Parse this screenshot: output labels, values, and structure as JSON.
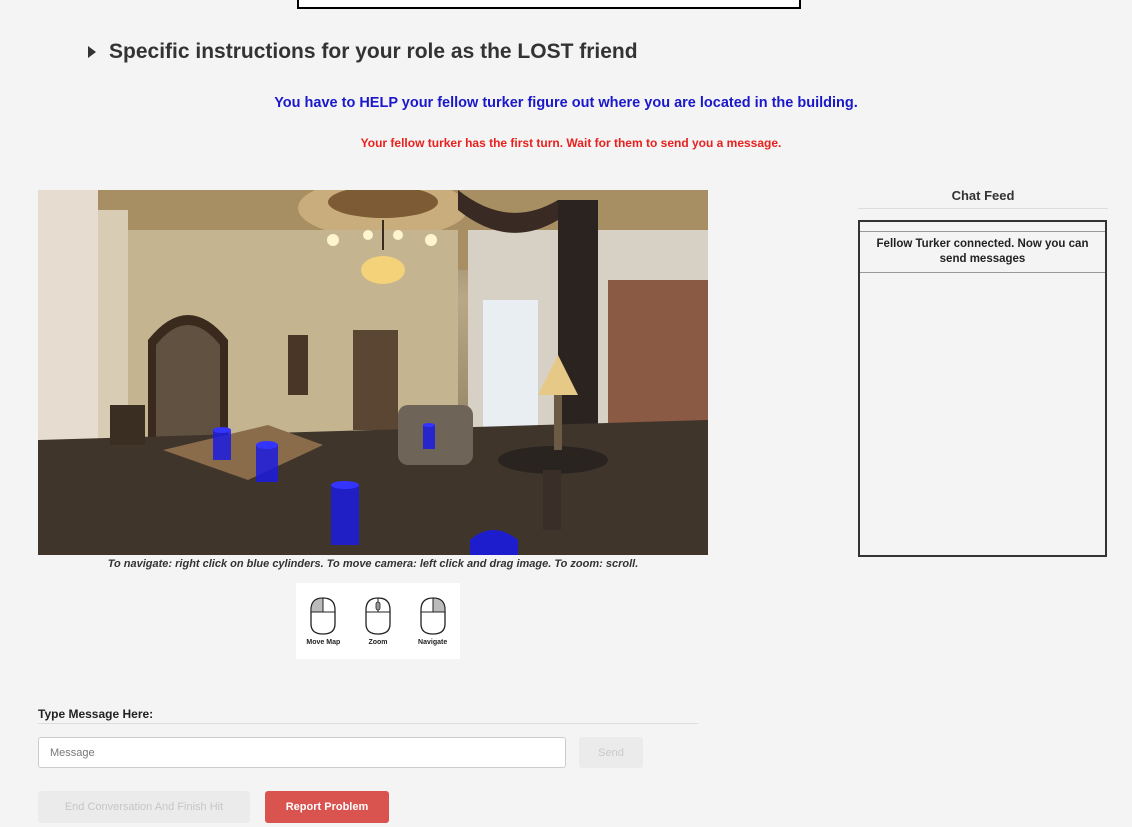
{
  "header": {
    "instructions_toggle": "Specific instructions for your role as the LOST friend",
    "help_text": "You have to HELP your fellow turker figure out where you are located in the building.",
    "turn_text": "Your fellow turker has the first turn. Wait for them to send you a message."
  },
  "viewer": {
    "nav_hint": "To navigate: right click on blue cylinders. To move camera: left click and drag image. To zoom: scroll.",
    "legend": {
      "move_map": "Move Map",
      "zoom": "Zoom",
      "navigate": "Navigate"
    }
  },
  "chat": {
    "title": "Chat Feed",
    "messages": [
      "Fellow Turker connected. Now you can send messages"
    ]
  },
  "composer": {
    "label": "Type Message Here:",
    "placeholder": "Message",
    "send_label": "Send"
  },
  "actions": {
    "end_label": "End Conversation And Finish Hit",
    "report_label": "Report Problem"
  },
  "colors": {
    "help_blue": "#1a18c9",
    "turn_red": "#e8201e",
    "report_red": "#d9534f",
    "nav_cylinder": "#1b1be0"
  }
}
